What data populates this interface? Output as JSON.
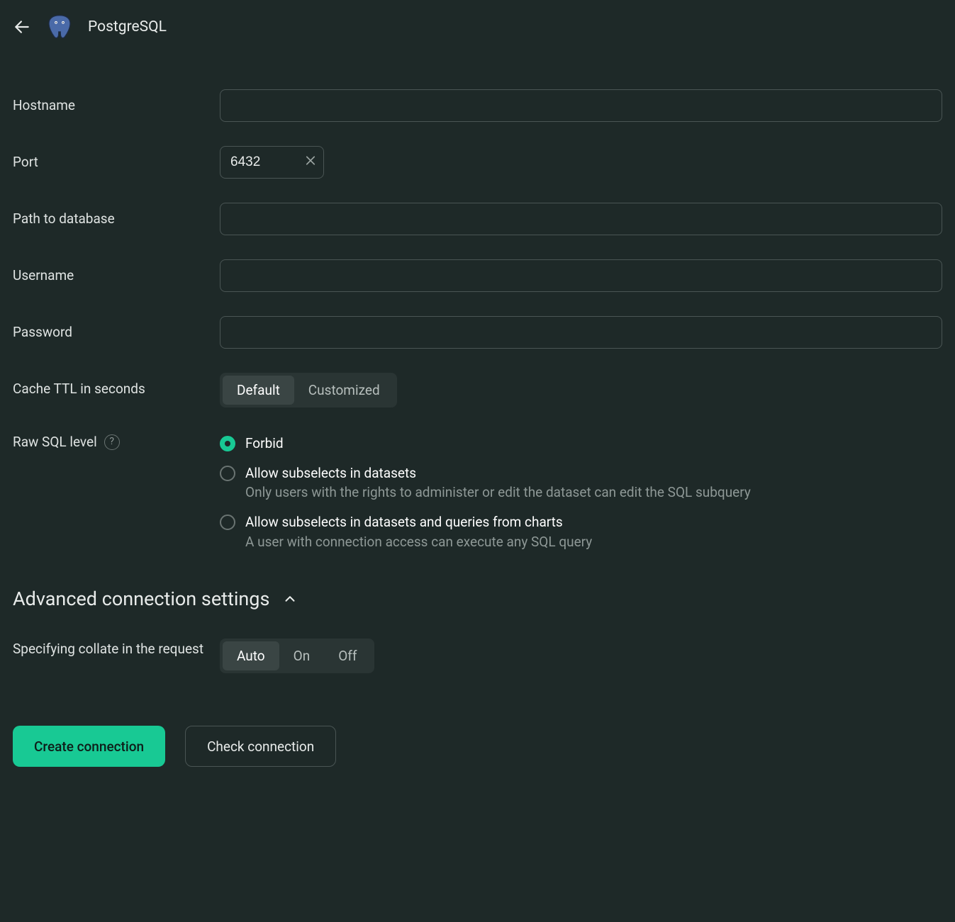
{
  "header": {
    "title": "PostgreSQL"
  },
  "fields": {
    "hostname": {
      "label": "Hostname",
      "value": ""
    },
    "port": {
      "label": "Port",
      "value": "6432"
    },
    "path": {
      "label": "Path to database",
      "value": ""
    },
    "username": {
      "label": "Username",
      "value": ""
    },
    "password": {
      "label": "Password",
      "value": ""
    }
  },
  "cache_ttl": {
    "label": "Cache TTL in seconds",
    "options": {
      "default": "Default",
      "custom": "Customized"
    },
    "selected": "default"
  },
  "raw_sql": {
    "label": "Raw SQL level",
    "selected": "forbid",
    "options": {
      "forbid": {
        "label": "Forbid",
        "desc": ""
      },
      "subselects": {
        "label": "Allow subselects in datasets",
        "desc": "Only users with the rights to administer or edit the dataset can edit the SQL subquery"
      },
      "subselects_charts": {
        "label": "Allow subselects in datasets and queries from charts",
        "desc": "A user with connection access can execute any SQL query"
      }
    }
  },
  "advanced": {
    "title": "Advanced connection settings",
    "collate": {
      "label": "Specifying collate in the request",
      "options": {
        "auto": "Auto",
        "on": "On",
        "off": "Off"
      },
      "selected": "auto"
    }
  },
  "actions": {
    "create": "Create connection",
    "check": "Check connection"
  }
}
